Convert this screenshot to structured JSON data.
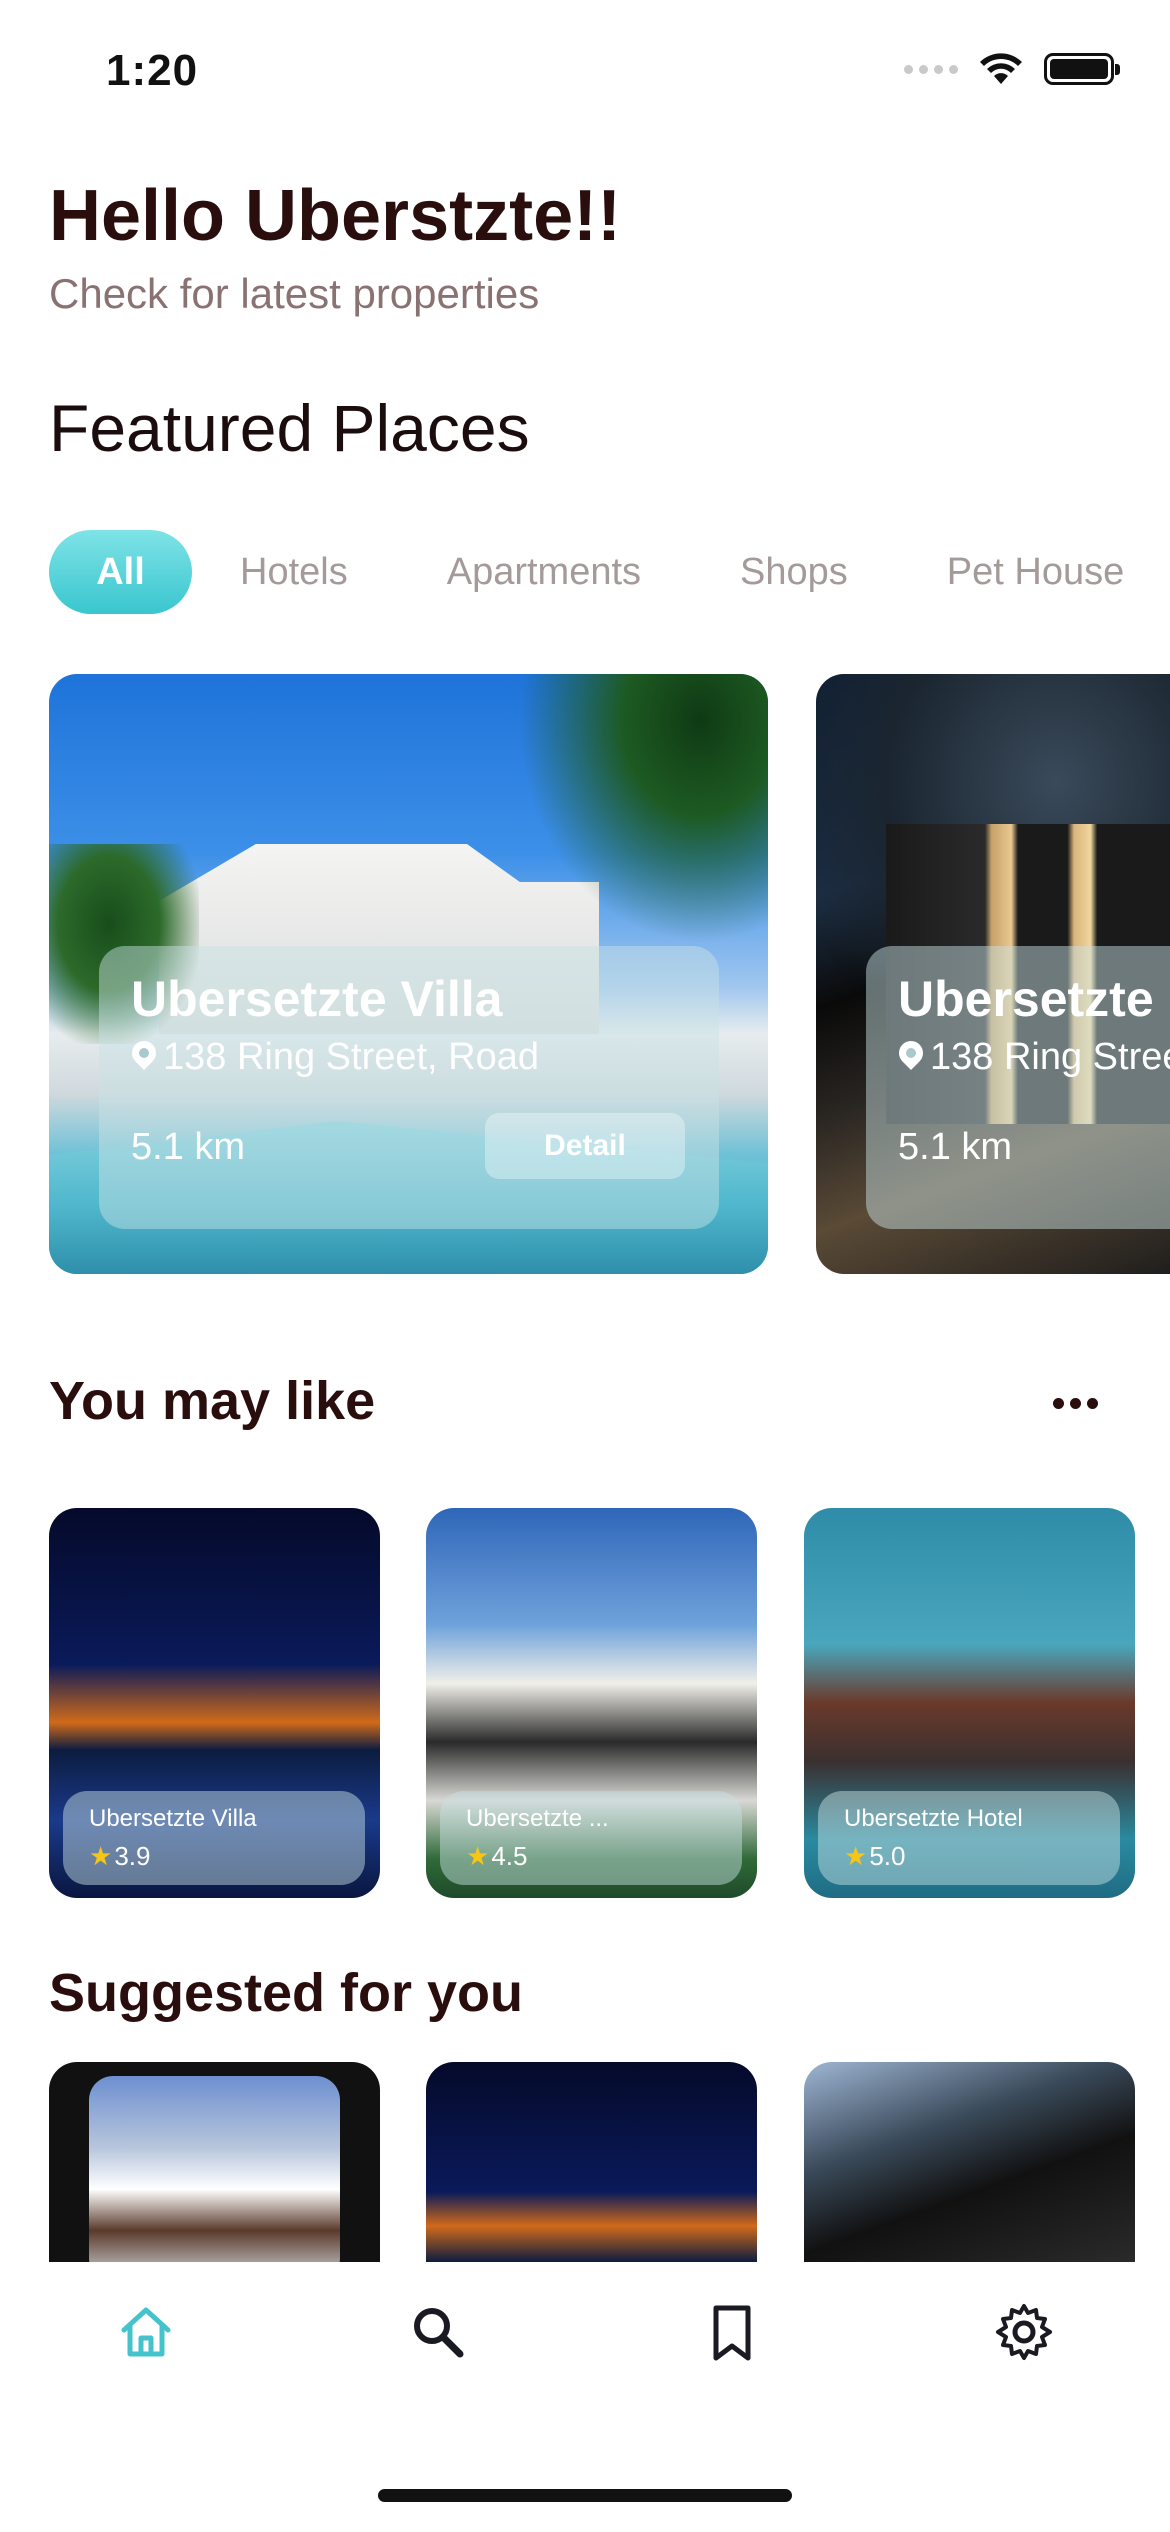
{
  "status": {
    "time": "1:20"
  },
  "header": {
    "greeting": "Hello Uberstzte!!",
    "subtitle": "Check for latest properties",
    "section_title": "Featured Places"
  },
  "filters": [
    "All",
    "Hotels",
    "Apartments",
    "Shops",
    "Pet House"
  ],
  "featured": [
    {
      "title": "Ubersetzte Villa",
      "address": "138 Ring Street, Road",
      "distance": "5.1 km",
      "button": "Detail"
    },
    {
      "title": "Ubersetzte",
      "address": "138 Ring Stree",
      "distance": "5.1 km"
    }
  ],
  "may_like": {
    "title": "You may like",
    "items": [
      {
        "title": "Ubersetzte Villa",
        "rating": "3.9"
      },
      {
        "title": "Ubersetzte ...",
        "rating": "4.5"
      },
      {
        "title": "Ubersetzte Hotel",
        "rating": "5.0"
      }
    ]
  },
  "suggested": {
    "title": "Suggested for you"
  },
  "tabs": [
    {
      "icon": "home-icon"
    },
    {
      "icon": "search-icon"
    },
    {
      "icon": "bookmark-icon"
    },
    {
      "icon": "gear-icon"
    }
  ],
  "colors": {
    "accent": "#3ec8d0",
    "heading": "#2a0e0e",
    "muted": "#8b7272"
  }
}
